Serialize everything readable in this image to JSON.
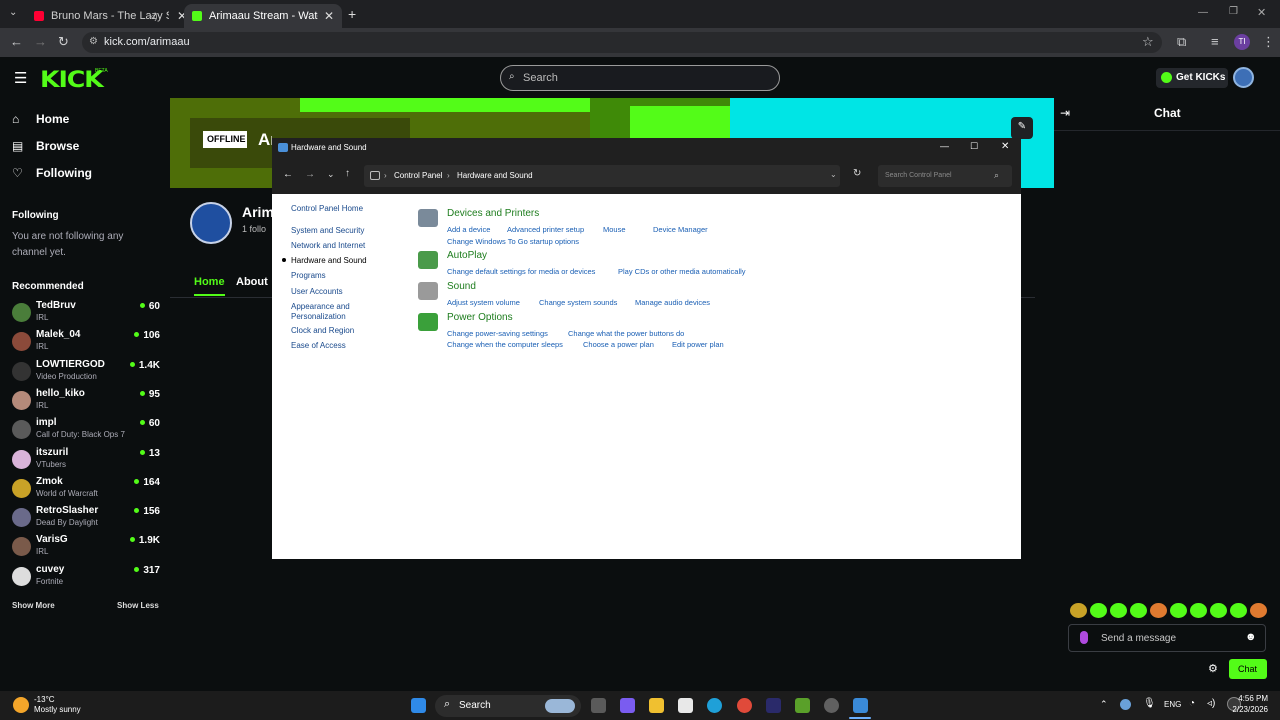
{
  "browser": {
    "tabs": [
      {
        "title": "Bruno Mars - The Lazy Song"
      },
      {
        "title": "Arimaau Stream - Watch Live o"
      }
    ],
    "new_tab_glyph": "+",
    "url": "kick.com/arimaau"
  },
  "kick": {
    "logo": "KICK",
    "logo_badge": "BETA",
    "search_placeholder": "Search",
    "get_kicks": "Get KICKs",
    "nav": [
      {
        "label": "Home",
        "icon": "home-icon"
      },
      {
        "label": "Browse",
        "icon": "browse-icon"
      },
      {
        "label": "Following",
        "icon": "heart-icon"
      }
    ],
    "following_heading": "Following",
    "following_empty": "You are not following any channel yet.",
    "recommended_heading": "Recommended",
    "recommended": [
      {
        "name": "TedBruv",
        "category": "IRL",
        "viewers": "60",
        "color": "#4a7d3a"
      },
      {
        "name": "Malek_04",
        "category": "IRL",
        "viewers": "106",
        "color": "#8b4a3a"
      },
      {
        "name": "LOWTIERGOD",
        "category": "Video Production",
        "viewers": "1.4K",
        "color": "#333333"
      },
      {
        "name": "hello_kiko",
        "category": "IRL",
        "viewers": "95",
        "color": "#b58a7a"
      },
      {
        "name": "impl",
        "category": "Call of Duty: Black Ops 7",
        "viewers": "60",
        "color": "#5a5a5a"
      },
      {
        "name": "itszuril",
        "category": "VTubers",
        "viewers": "13",
        "color": "#d9b3d9"
      },
      {
        "name": "Zmok",
        "category": "World of Warcraft",
        "viewers": "164",
        "color": "#c9a227"
      },
      {
        "name": "RetroSlasher",
        "category": "Dead By Daylight",
        "viewers": "156",
        "color": "#6a6a8a"
      },
      {
        "name": "VarisG",
        "category": "IRL",
        "viewers": "1.9K",
        "color": "#7a5a4a"
      },
      {
        "name": "cuvey",
        "category": "Fortnite",
        "viewers": "317",
        "color": "#dddddd"
      }
    ],
    "show_more": "Show More",
    "show_less": "Show Less",
    "offline_badge": "OFFLINE",
    "banner_text": "Arimaau is offline",
    "channel_name": "Arim",
    "followers_text": "1 follo",
    "channel_tabs": [
      "Home",
      "About"
    ],
    "chat_title": "Chat",
    "send_message_placeholder": "Send a message",
    "chat_button": "Chat",
    "accent": "#53fc18"
  },
  "control_panel": {
    "window_title": "Hardware and Sound",
    "breadcrumb": [
      "Control Panel",
      "Hardware and Sound"
    ],
    "search_placeholder": "Search Control Panel",
    "left_nav": [
      {
        "label": "Control Panel Home",
        "active": false
      },
      {
        "label": "System and Security",
        "active": false
      },
      {
        "label": "Network and Internet",
        "active": false
      },
      {
        "label": "Hardware and Sound",
        "active": true
      },
      {
        "label": "Programs",
        "active": false
      },
      {
        "label": "User Accounts",
        "active": false
      },
      {
        "label": "Appearance and Personalization",
        "active": false
      },
      {
        "label": "Clock and Region",
        "active": false
      },
      {
        "label": "Ease of Access",
        "active": false
      }
    ],
    "categories": [
      {
        "title": "Devices and Printers",
        "icon": "printer-icon",
        "links": [
          [
            "Add a device",
            "Advanced printer setup",
            "Mouse",
            "Device Manager"
          ],
          [
            "Change Windows To Go startup options"
          ]
        ]
      },
      {
        "title": "AutoPlay",
        "icon": "autoplay-icon",
        "links": [
          [
            "Change default settings for media or devices",
            "Play CDs or other media automatically"
          ]
        ]
      },
      {
        "title": "Sound",
        "icon": "speaker-icon",
        "links": [
          [
            "Adjust system volume",
            "Change system sounds",
            "Manage audio devices"
          ]
        ]
      },
      {
        "title": "Power Options",
        "icon": "battery-icon",
        "links": [
          [
            "Change power-saving settings",
            "Change what the power buttons do"
          ],
          [
            "Change when the computer sleeps",
            "Choose a power plan",
            "Edit power plan"
          ]
        ]
      }
    ]
  },
  "taskbar": {
    "weather_temp": "-13°C",
    "weather_desc": "Mostly sunny",
    "search_label": "Search",
    "language": "ENG",
    "time": "4:56 PM",
    "date": "2/23/2026"
  }
}
